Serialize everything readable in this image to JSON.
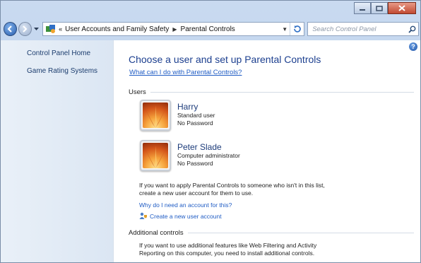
{
  "window": {
    "caption": {
      "minimize": "minimize",
      "maximize": "maximize",
      "close": "close"
    }
  },
  "navbar": {
    "breadcrumb": [
      "User Accounts and Family Safety",
      "Parental Controls"
    ],
    "search_placeholder": "Search Control Panel"
  },
  "sidebar": {
    "items": [
      {
        "label": "Control Panel Home"
      },
      {
        "label": "Game Rating Systems"
      }
    ]
  },
  "main": {
    "title": "Choose a user and set up Parental Controls",
    "help_link": "What can I do with Parental Controls?",
    "users_heading": "Users",
    "users": [
      {
        "name": "Harry",
        "role": "Standard user",
        "password": "No Password"
      },
      {
        "name": "Peter Slade",
        "role": "Computer administrator",
        "password": "No Password"
      }
    ],
    "apply_text_1": "If you want to apply Parental Controls to someone who isn't in this list,",
    "apply_text_2": "create a new user account for them to use.",
    "why_link": "Why do I need an account for this?",
    "create_link": "Create a new user account",
    "additional_heading": "Additional controls",
    "additional_text_1": "If you want to use additional features like Web Filtering and Activity",
    "additional_text_2": "Reporting on this computer, you need to install additional controls.",
    "help_glyph": "?"
  },
  "colors": {
    "link": "#1f5cc4",
    "title": "#1c3f8f",
    "sidebar_bg": "#dbe6f3"
  }
}
